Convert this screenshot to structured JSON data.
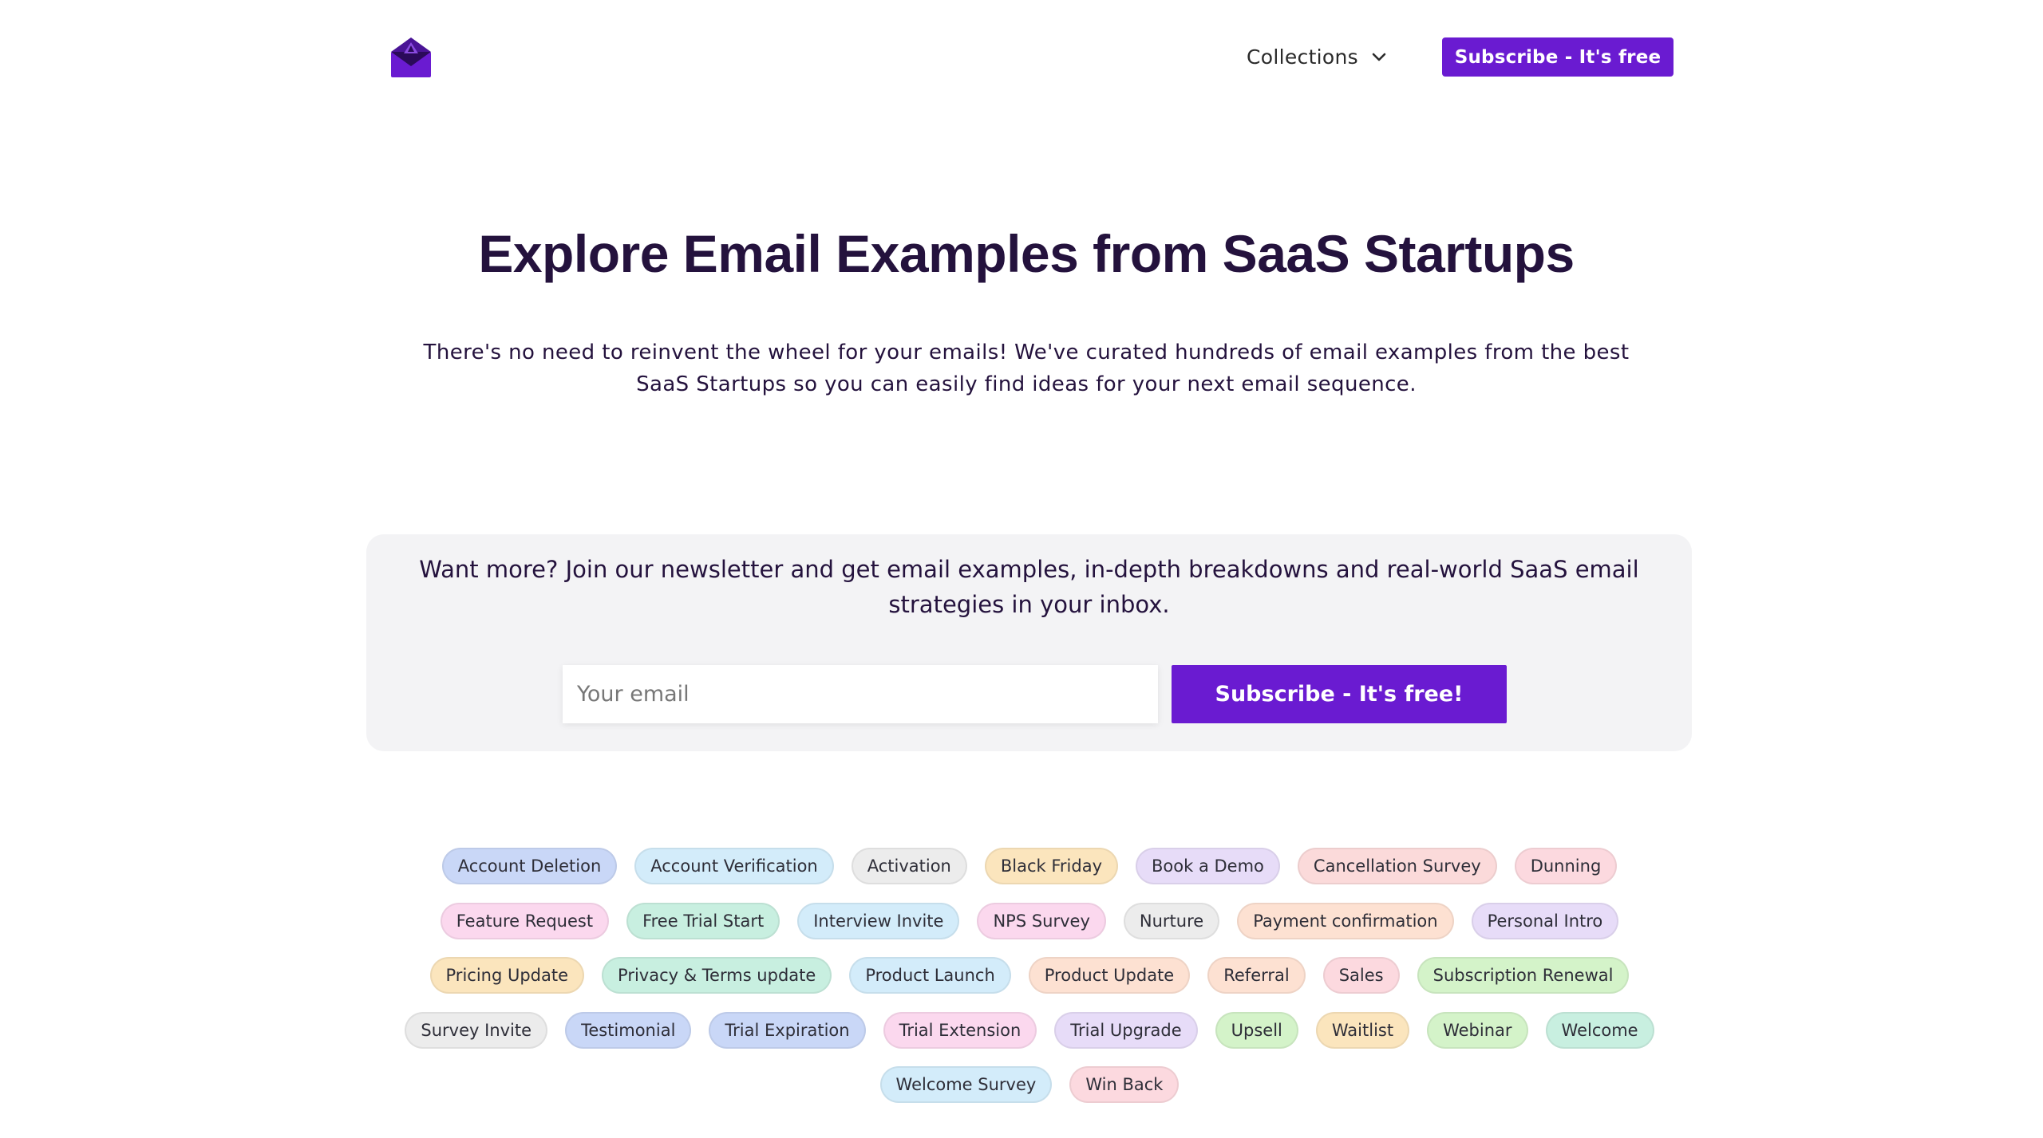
{
  "header": {
    "collections_label": "Collections",
    "subscribe_label": "Subscribe - It's free",
    "logo_icon": "envelope-logo-icon",
    "chevron_icon": "chevron-down-icon",
    "brand_color": "#6a1bd1"
  },
  "hero": {
    "title": "Explore Email Examples from SaaS Startups",
    "description": "There's no need to reinvent the wheel for your emails! We've curated hundreds of email examples from the best SaaS Startups so you can easily find ideas for your next email sequence."
  },
  "newsletter": {
    "text": "Want more? Join our newsletter and get email examples, in-depth breakdowns and real-world SaaS email strategies in your inbox.",
    "email_placeholder": "Your email",
    "email_value": "",
    "subscribe_label": "Subscribe - It's free!"
  },
  "tags": {
    "rows": [
      [
        {
          "label": "Account Deletion",
          "color": "#c9d7f7"
        },
        {
          "label": "Account Verification",
          "color": "#d3ecfa"
        },
        {
          "label": "Activation",
          "color": "#ececec"
        },
        {
          "label": "Black Friday",
          "color": "#fbe5bd"
        },
        {
          "label": "Book a Demo",
          "color": "#e7dcf8"
        },
        {
          "label": "Cancellation Survey",
          "color": "#fbdada"
        },
        {
          "label": "Dunning",
          "color": "#fcd9df"
        }
      ],
      [
        {
          "label": "Feature Request",
          "color": "#fbd8ee"
        },
        {
          "label": "Free Trial Start",
          "color": "#c8efe0"
        },
        {
          "label": "Interview Invite",
          "color": "#d3ecfa"
        },
        {
          "label": "NPS Survey",
          "color": "#fbd8ee"
        },
        {
          "label": "Nurture",
          "color": "#ececec"
        },
        {
          "label": "Payment confirmation",
          "color": "#fde1d2"
        },
        {
          "label": "Personal Intro",
          "color": "#e7dcf8"
        }
      ],
      [
        {
          "label": "Pricing Update",
          "color": "#fbe5bd"
        },
        {
          "label": "Privacy & Terms update",
          "color": "#c8efe0"
        },
        {
          "label": "Product Launch",
          "color": "#d3ecfa"
        },
        {
          "label": "Product Update",
          "color": "#fde1d2"
        },
        {
          "label": "Referral",
          "color": "#fde1d2"
        },
        {
          "label": "Sales",
          "color": "#fcd9df"
        },
        {
          "label": "Subscription Renewal",
          "color": "#d4f3c9"
        }
      ],
      [
        {
          "label": "Survey Invite",
          "color": "#ececec"
        },
        {
          "label": "Testimonial",
          "color": "#c9d7f7"
        },
        {
          "label": "Trial Expiration",
          "color": "#c9d7f7"
        },
        {
          "label": "Trial Extension",
          "color": "#fbd8ee"
        },
        {
          "label": "Trial Upgrade",
          "color": "#e7dcf8"
        },
        {
          "label": "Upsell",
          "color": "#d4f3c9"
        },
        {
          "label": "Waitlist",
          "color": "#fbe5bd"
        },
        {
          "label": "Webinar",
          "color": "#d4f3c9"
        },
        {
          "label": "Welcome",
          "color": "#c8efe0"
        }
      ],
      [
        {
          "label": "Welcome Survey",
          "color": "#d3ecfa"
        },
        {
          "label": "Win Back",
          "color": "#fcd9df"
        }
      ]
    ]
  }
}
